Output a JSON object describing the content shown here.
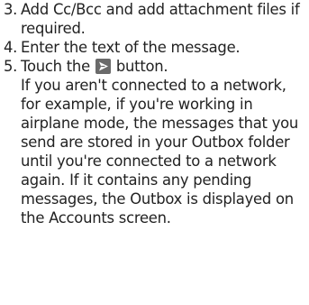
{
  "steps": [
    {
      "number": "3.",
      "text": "Add Cc/Bcc and add attachment files if required."
    },
    {
      "number": "4.",
      "text": "Enter the text of the message."
    },
    {
      "number": "5.",
      "text_before": "Touch the",
      "text_after": "button."
    }
  ],
  "send_icon": {
    "name": "send-icon",
    "bg_color": "#6a6a6a",
    "fg_color": "#ffffff"
  },
  "note": "If you aren't connected to a network, for example, if you're working in airplane mode, the messages that you send are stored in your Outbox folder until you're connected to a network again. If it contains any pending messages, the Outbox is displayed on the Accounts screen."
}
